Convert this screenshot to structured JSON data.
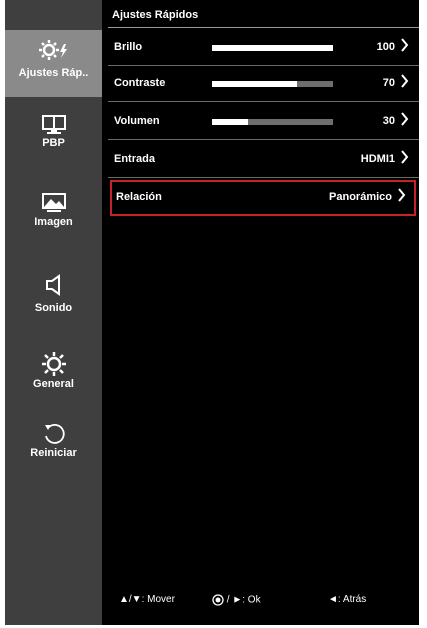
{
  "sidebar": {
    "items": [
      {
        "label": "Ajustes Ráp..",
        "icon": "quick-settings-icon",
        "active": true
      },
      {
        "label": "PBP",
        "icon": "pbp-icon",
        "active": false
      },
      {
        "label": "Imagen",
        "icon": "picture-icon",
        "active": false
      },
      {
        "label": "Sonido",
        "icon": "speaker-icon",
        "active": false
      },
      {
        "label": "General",
        "icon": "gear-icon",
        "active": false
      },
      {
        "label": "Reiniciar",
        "icon": "reset-icon",
        "active": false
      }
    ]
  },
  "main": {
    "title": "Ajustes Rápidos",
    "rows": [
      {
        "label": "Brillo",
        "value": "100",
        "level": 100
      },
      {
        "label": "Contraste",
        "value": "70",
        "level": 70
      },
      {
        "label": "Volumen",
        "value": "30",
        "level": 30
      },
      {
        "label": "Entrada",
        "value": "HDMI1"
      },
      {
        "label": "Relación",
        "value": "Panorámico",
        "highlighted": true
      }
    ]
  },
  "footer": {
    "move": "▲/▼: Mover",
    "ok": "/ ►: Ok",
    "back": "◄: Atrás"
  },
  "colors": {
    "sidebar_bg": "#3f3f3f",
    "active_bg": "#8a8a8a",
    "highlight_border": "#c4232b",
    "bar_track": "#6e6e6e",
    "bar_fill": "#ffffff"
  }
}
